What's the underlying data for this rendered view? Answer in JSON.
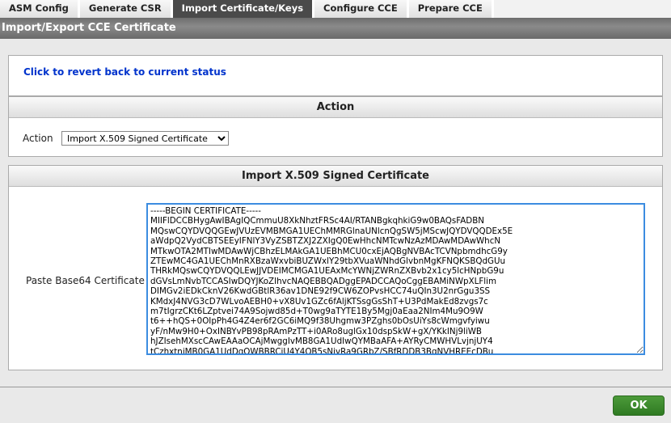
{
  "tabs": [
    {
      "label": "ASM Config"
    },
    {
      "label": "Generate CSR"
    },
    {
      "label": "Import Certificate/Keys"
    },
    {
      "label": "Configure CCE"
    },
    {
      "label": "Prepare CCE"
    }
  ],
  "header": {
    "title": "Import/Export CCE Certificate"
  },
  "revert": {
    "label": "Click to revert back to current status"
  },
  "action_panel": {
    "title": "Action",
    "field_label": "Action",
    "selected": "Import X.509 Signed Certificate"
  },
  "import_panel": {
    "title": "Import X.509 Signed Certificate",
    "field_label": "Paste Base64 Certificate",
    "certificate": "-----BEGIN CERTIFICATE-----\nMIIFlDCCBHygAwIBAgIQCmmuU8XkNhztFRSc4AI/RTANBgkqhkiG9w0BAQsFADBN\nMQswCQYDVQQGEwJVUzEVMBMGA1UEChMMRGlnaUNlcnQgSW5jMScwJQYDVQQDEx5E\naWdpQ2VydCBTSEEyIFNlY3VyZSBTZXJ2ZXIgQ0EwHhcNMTcwNzAzMDAwMDAwWhcN\nMTkwOTA2MTIwMDAwWjCBhzELMAkGA1UEBhMCU0cxEjAQBgNVBAcTCVNpbmdhcG9y\nZTEwMC4GA1UEChMnRXBzaWxvbiBUZWxlY29tbXVuaWNhdGlvbnMgKFNQKSBQdGUu\nTHRkMQswCQYDVQQLEwJJVDEIMCMGA1UEAxMcYWNjZWRnZXBvb2x1cy5lcHNpbG9u\ndGVsLmNvbTCCASIwDQYJKoZIhvcNAQEBBQADggEPADCCAQoCggEBAMiNWpXLFlim\nDIMGv2iEDkCknV26KwdGBtlR36av1DNE92f9CW6ZOPvsHCC74uQIn3U2nrGgu3SS\nKMdxJ4NVG3cD7WLvoAEBH0+vX8Uv1GZc6fAljKTSsgGsShT+U3PdMakEd8zvgs7c\nm7tIgrzCKt6LZptvei74A9Sojwd85d+T0wg9aTYTE1By5Mgj0aEaa2NIm4Mu9O9W\nt6++hQS+0OIpPh4G4Z4er6f2GC6iMQ9f38Uhgmw3PZghs0bOsUiYs8cWmgvfyiwu\nyF/nMw9H0+OxINBYvPB98pRAmPzTT+i0ARo8uglGx10dspSkW+gX/YKkINj9liWB\nhJZIsehMXscCAwEAAaOCAjMwggIvMB8GA1UdIwQYMBaAFA+AYRyCMWHVLvjnjUY4\ntCzhxtniMB0GA1UdDgQWBBRCiU4Y4QB5sNivRa9GRbZ/SBfRDDB3BgNVHREEcDBu"
  },
  "footer": {
    "ok_label": "OK"
  }
}
